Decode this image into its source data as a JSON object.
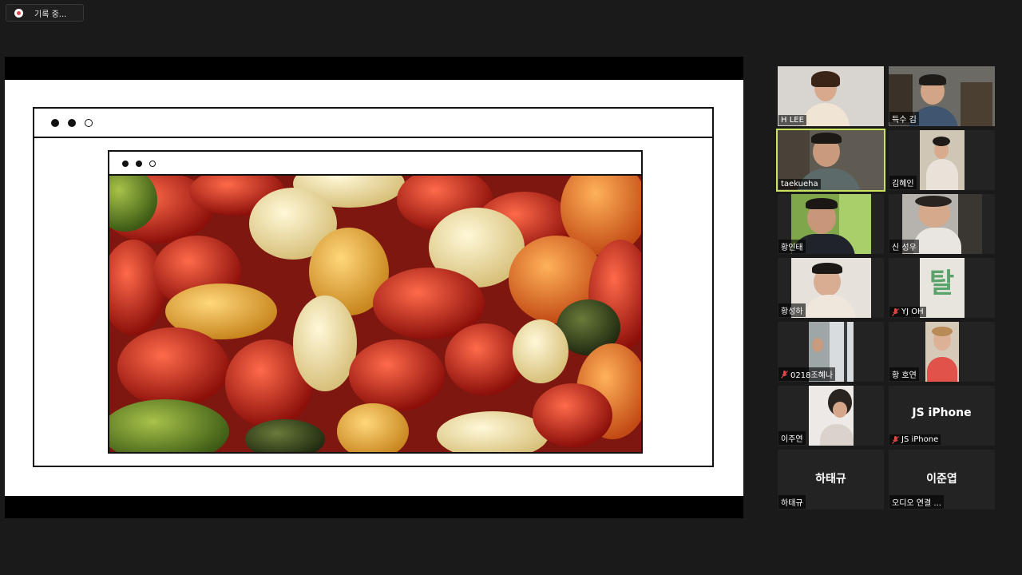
{
  "recording": {
    "label": "기록 중..."
  },
  "slide": {
    "outer_dots": [
      "filled",
      "filled",
      "hollow"
    ],
    "inner_dots": [
      "filled",
      "filled",
      "hollow"
    ],
    "image_subject": "gummy-bears-photo"
  },
  "participants": [
    {
      "name": "H LEE",
      "muted": false,
      "video": true,
      "active": false
    },
    {
      "name": "득수 김",
      "muted": false,
      "video": true,
      "active": false
    },
    {
      "name": "taekueha",
      "muted": false,
      "video": true,
      "active": true
    },
    {
      "name": "김혜인",
      "muted": false,
      "video": true,
      "active": false
    },
    {
      "name": "황인태",
      "muted": false,
      "video": true,
      "active": false
    },
    {
      "name": "신 성우",
      "muted": false,
      "video": true,
      "active": false
    },
    {
      "name": "황성하",
      "muted": false,
      "video": true,
      "active": false
    },
    {
      "name": "YJ OH",
      "muted": true,
      "video": true,
      "active": false,
      "video_text": "탈"
    },
    {
      "name": "0218조혜나",
      "muted": true,
      "video": true,
      "active": false
    },
    {
      "name": "황 호연",
      "muted": false,
      "video": true,
      "active": false
    },
    {
      "name": "이주연",
      "muted": false,
      "video": true,
      "active": false
    },
    {
      "name": "JS iPhone",
      "muted": true,
      "video": false,
      "active": false,
      "display_name": "JS iPhone"
    },
    {
      "name": "하태규",
      "muted": false,
      "video": false,
      "active": false,
      "display_name": "하태규"
    },
    {
      "name": "오디오 연결 ...",
      "muted": false,
      "video": false,
      "active": false,
      "display_name": "이준엽"
    }
  ],
  "colors": {
    "active_speaker": "#c9e35b",
    "mute": "#e04848",
    "record": "#e34b4b"
  }
}
